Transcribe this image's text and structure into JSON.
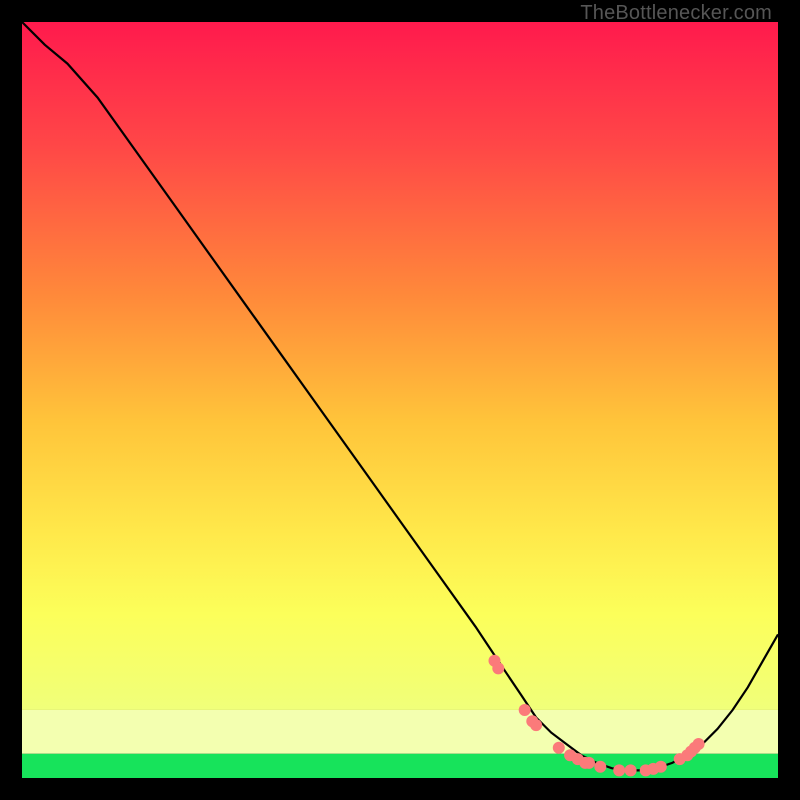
{
  "watermark": "TheBottlenecker.com",
  "chart_data": {
    "type": "line",
    "title": "",
    "xlabel": "",
    "ylabel": "",
    "xlim": [
      0,
      100
    ],
    "ylim": [
      0,
      100
    ],
    "x": [
      0,
      3,
      6,
      10,
      15,
      20,
      25,
      30,
      35,
      40,
      45,
      50,
      55,
      60,
      62,
      64,
      66,
      68,
      70,
      72,
      74,
      76,
      78,
      80,
      82,
      84,
      86,
      88,
      90,
      92,
      94,
      96,
      98,
      100
    ],
    "values": [
      100,
      97,
      94.5,
      90,
      83,
      76,
      69,
      62,
      55,
      48,
      41,
      34,
      27,
      20,
      17,
      14,
      11,
      8,
      6,
      4.5,
      3,
      2,
      1.3,
      1,
      1,
      1.3,
      2,
      3,
      4.5,
      6.5,
      9,
      12,
      15.5,
      19
    ],
    "markers_x": [
      62.5,
      63,
      66.5,
      67.5,
      68,
      71,
      72.5,
      73.5,
      74.5,
      75,
      76.5,
      79,
      80.5,
      82.5,
      83.5,
      84.5,
      87,
      88,
      88.5,
      89,
      89.5
    ],
    "markers_y": [
      15.5,
      14.5,
      9,
      7.5,
      7,
      4,
      3,
      2.5,
      2,
      2,
      1.5,
      1,
      1,
      1,
      1.2,
      1.5,
      2.5,
      3,
      3.5,
      4,
      4.5
    ],
    "marker_color": "#fb7a7a",
    "line_color": "#000000",
    "green_band": {
      "y0": 0,
      "y1": 3.2
    },
    "yellow_band": {
      "y0": 3.2,
      "y1": 9
    },
    "gradient_stops": [
      {
        "offset": 0,
        "color": "#ff1a4d"
      },
      {
        "offset": 18,
        "color": "#ff4747"
      },
      {
        "offset": 40,
        "color": "#ff8a3a"
      },
      {
        "offset": 58,
        "color": "#ffc43a"
      },
      {
        "offset": 74,
        "color": "#ffe84a"
      },
      {
        "offset": 86,
        "color": "#fcff5a"
      },
      {
        "offset": 100,
        "color": "#f0ff7a"
      }
    ]
  }
}
